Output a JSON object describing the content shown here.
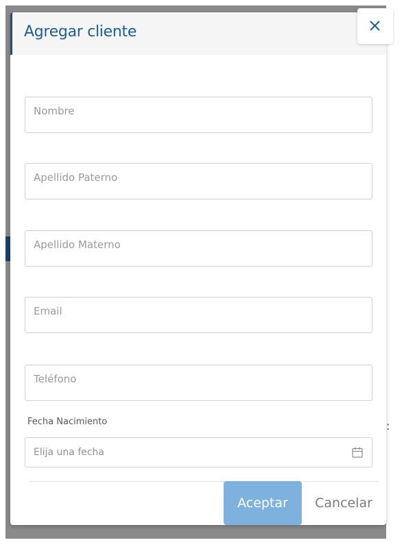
{
  "modal": {
    "title": "Agregar cliente",
    "close_icon": "close-icon"
  },
  "form": {
    "nombre": {
      "placeholder": "Nombre",
      "value": ""
    },
    "apellido_paterno": {
      "placeholder": "Apellido Paterno",
      "value": ""
    },
    "apellido_materno": {
      "placeholder": "Apellido Materno",
      "value": ""
    },
    "email": {
      "placeholder": "Email",
      "value": ""
    },
    "telefono": {
      "placeholder": "Teléfono",
      "value": ""
    },
    "fecha_nacimiento": {
      "label": "Fecha Nacimiento",
      "placeholder": "Elija una fecha",
      "value": "",
      "icon": "calendar-icon"
    }
  },
  "actions": {
    "accept_label": "Aceptar",
    "cancel_label": "Cancelar"
  },
  "background": {
    "colon": ":"
  },
  "colors": {
    "title": "#1c5d9c",
    "accent_border": "#1f4f82",
    "accept_button": "#7fb1df"
  }
}
